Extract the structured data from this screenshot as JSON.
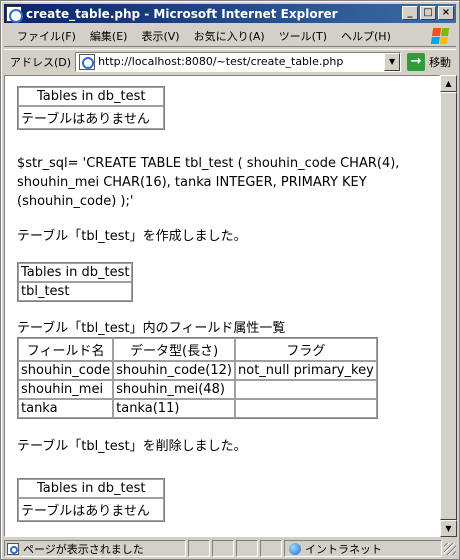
{
  "window": {
    "title": "create_table.php - Microsoft Internet Explorer",
    "buttons": {
      "minimize": "_",
      "maximize": "□",
      "close": "×"
    }
  },
  "menu": {
    "items": [
      "ファイル(F)",
      "編集(E)",
      "表示(V)",
      "お気に入り(A)",
      "ツール(T)",
      "ヘルプ(H)"
    ]
  },
  "address": {
    "label": "アドレス(D)",
    "url": "http://localhost:8080/~test/create_table.php",
    "go_label": "移動"
  },
  "content": {
    "tables1": {
      "header": "Tables in db_test",
      "message": "テーブルはありません"
    },
    "sql": "$str_sql= 'CREATE TABLE tbl_test ( shouhin_code CHAR(4), shouhin_mei CHAR(16), tanka INTEGER, PRIMARY KEY (shouhin_code) );'",
    "created_msg": "テーブル「tbl_test」を作成しました。",
    "tables2": {
      "header": "Tables in db_test",
      "rows": [
        "tbl_test"
      ]
    },
    "fields_caption": "テーブル「tbl_test」内のフィールド属性一覧",
    "fields": {
      "headers": [
        "フィールド名",
        "データ型(長さ)",
        "フラグ"
      ],
      "rows": [
        [
          "shouhin_code",
          "shouhin_code(12)",
          "not_null primary_key"
        ],
        [
          "shouhin_mei",
          "shouhin_mei(48)",
          ""
        ],
        [
          "tanka",
          "tanka(11)",
          ""
        ]
      ]
    },
    "deleted_msg": "テーブル「tbl_test」を削除しました。",
    "tables3": {
      "header": "Tables in db_test",
      "message": "テーブルはありません"
    }
  },
  "status": {
    "text": "ページが表示されました",
    "zone": "イントラネット"
  }
}
